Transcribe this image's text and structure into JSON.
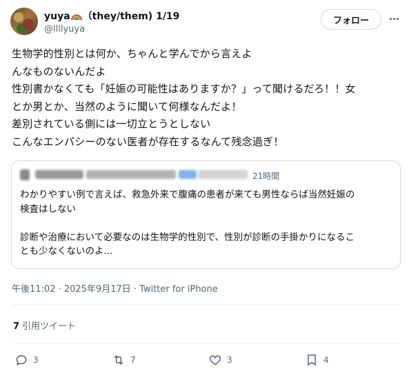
{
  "author": {
    "display_name": "yuya",
    "pronouns_and_thread": "（they/them) 1/19",
    "handle": "@llllyuya"
  },
  "follow_button": "フォロー",
  "tweet_lines": [
    "生物学的性別とは何か、ちゃんと学んでから言えよ",
    "んなものないんだよ",
    "性別書かなくても「妊娠の可能性はありますか？」って聞けるだろ！！女",
    "とか男とか、当然のように聞いて何様なんだよ！",
    "差別されている側には一切立とうとしない",
    "こんなエンパシーのない医者が存在するなんて残念過ぎ！"
  ],
  "quote": {
    "time": "21時間",
    "lines": [
      "わかりやすい例で言えば、救急外来で腹痛の患者が来ても男性ならば当然妊娠の",
      "検査はしない",
      "",
      "診断や治療において必要なのは生物学的性別で、性別が診断の手掛かりになるこ",
      "とも少なくないのよ..."
    ]
  },
  "meta": "午後11:02 · 2025年9月17日 · Twitter for iPhone",
  "stats": {
    "quote_count": "7",
    "quote_label": "引用ツイート"
  },
  "actions": {
    "reply": "3",
    "retweet": "7",
    "like": "3",
    "bookmark": "4"
  }
}
